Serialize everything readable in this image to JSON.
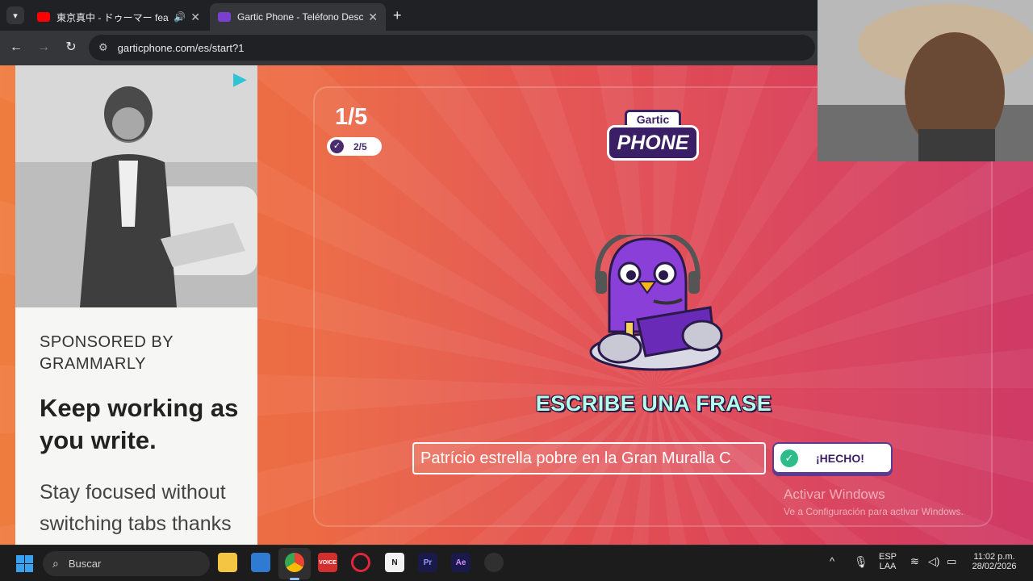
{
  "browser": {
    "tabs": [
      {
        "title": "東京真中 - ドゥーマー feat. 重音",
        "audio": true,
        "active": false,
        "favicon_color": "#ff0000"
      },
      {
        "title": "Gartic Phone - Teléfono Descon",
        "audio": false,
        "active": true,
        "favicon_color": "#7a3fcf"
      }
    ],
    "new_tab": "+",
    "url": "garticphone.com/es/start?1"
  },
  "ad": {
    "sponsor": "SPONSORED BY GRAMMARLY",
    "headline": "Keep working as you write.",
    "body": "Stay focused without switching tabs thanks"
  },
  "game": {
    "round": "1/5",
    "done_count": "2/5",
    "logo_top": "Gartic",
    "logo_main": "PHONE",
    "headline": "ESCRIBE UNA FRASE",
    "phrase_value": "Patrício estrella pobre en la Gran Muralla C",
    "done_button": "¡HECHO!"
  },
  "watermark": {
    "title": "Activar Windows",
    "subtitle": "Ve a Configuración para activar Windows."
  },
  "taskbar": {
    "search_placeholder": "Buscar",
    "apps": [
      "file-explorer",
      "microsoft-store",
      "chrome",
      "voicemeeter",
      "opera",
      "notion",
      "premiere-pro",
      "after-effects",
      "obs"
    ],
    "language_top": "ESP",
    "language_bottom": "LAA",
    "time": "11:02 p.m.",
    "date": "28/02/2026"
  },
  "colors": {
    "accent_purple": "#3a1f66",
    "headline_mint": "#b4ffe8",
    "done_green": "#2dbd8a"
  }
}
